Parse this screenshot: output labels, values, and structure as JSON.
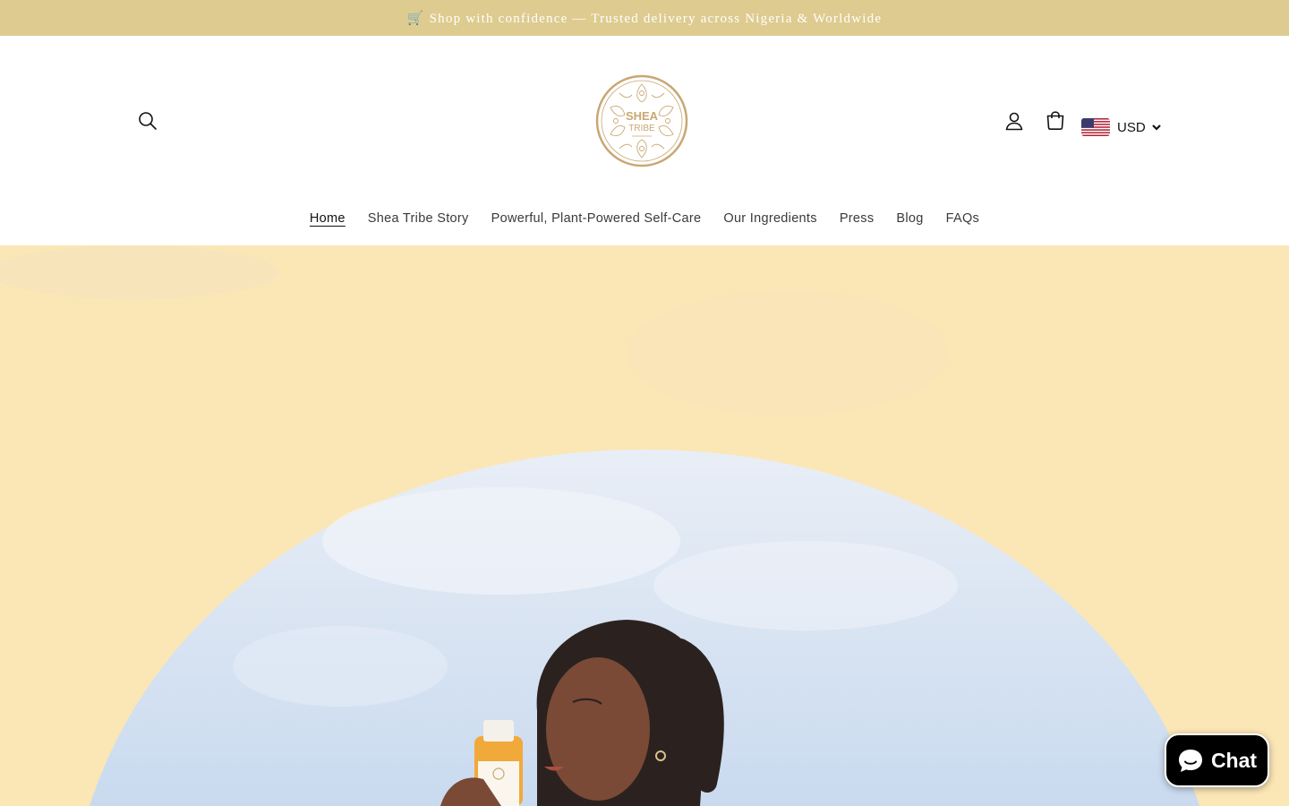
{
  "announcement": {
    "text": "🛒 Shop with confidence — Trusted delivery across Nigeria & Worldwide"
  },
  "header": {
    "logo": {
      "line1": "SHEA",
      "line2": "TRIBE"
    },
    "currency": {
      "code": "USD",
      "flag": "us-flag-icon"
    },
    "icons": {
      "search": "search-icon",
      "account": "account-icon",
      "cart": "cart-icon"
    }
  },
  "nav": {
    "items": [
      {
        "label": "Home",
        "active": true
      },
      {
        "label": "Shea Tribe Story",
        "active": false
      },
      {
        "label": "Powerful, Plant-Powered Self-Care",
        "active": false
      },
      {
        "label": "Our Ingredients",
        "active": false
      },
      {
        "label": "Press",
        "active": false
      },
      {
        "label": "Blog",
        "active": false
      },
      {
        "label": "FAQs",
        "active": false
      }
    ]
  },
  "hero": {
    "background_color": "#fbe6b6",
    "arch_color": "#dbe6f3"
  },
  "chat": {
    "label": "Chat"
  },
  "colors": {
    "announcement_bg": "#decb8f",
    "logo_gold": "#c9a772",
    "chat_bg": "#000000"
  }
}
